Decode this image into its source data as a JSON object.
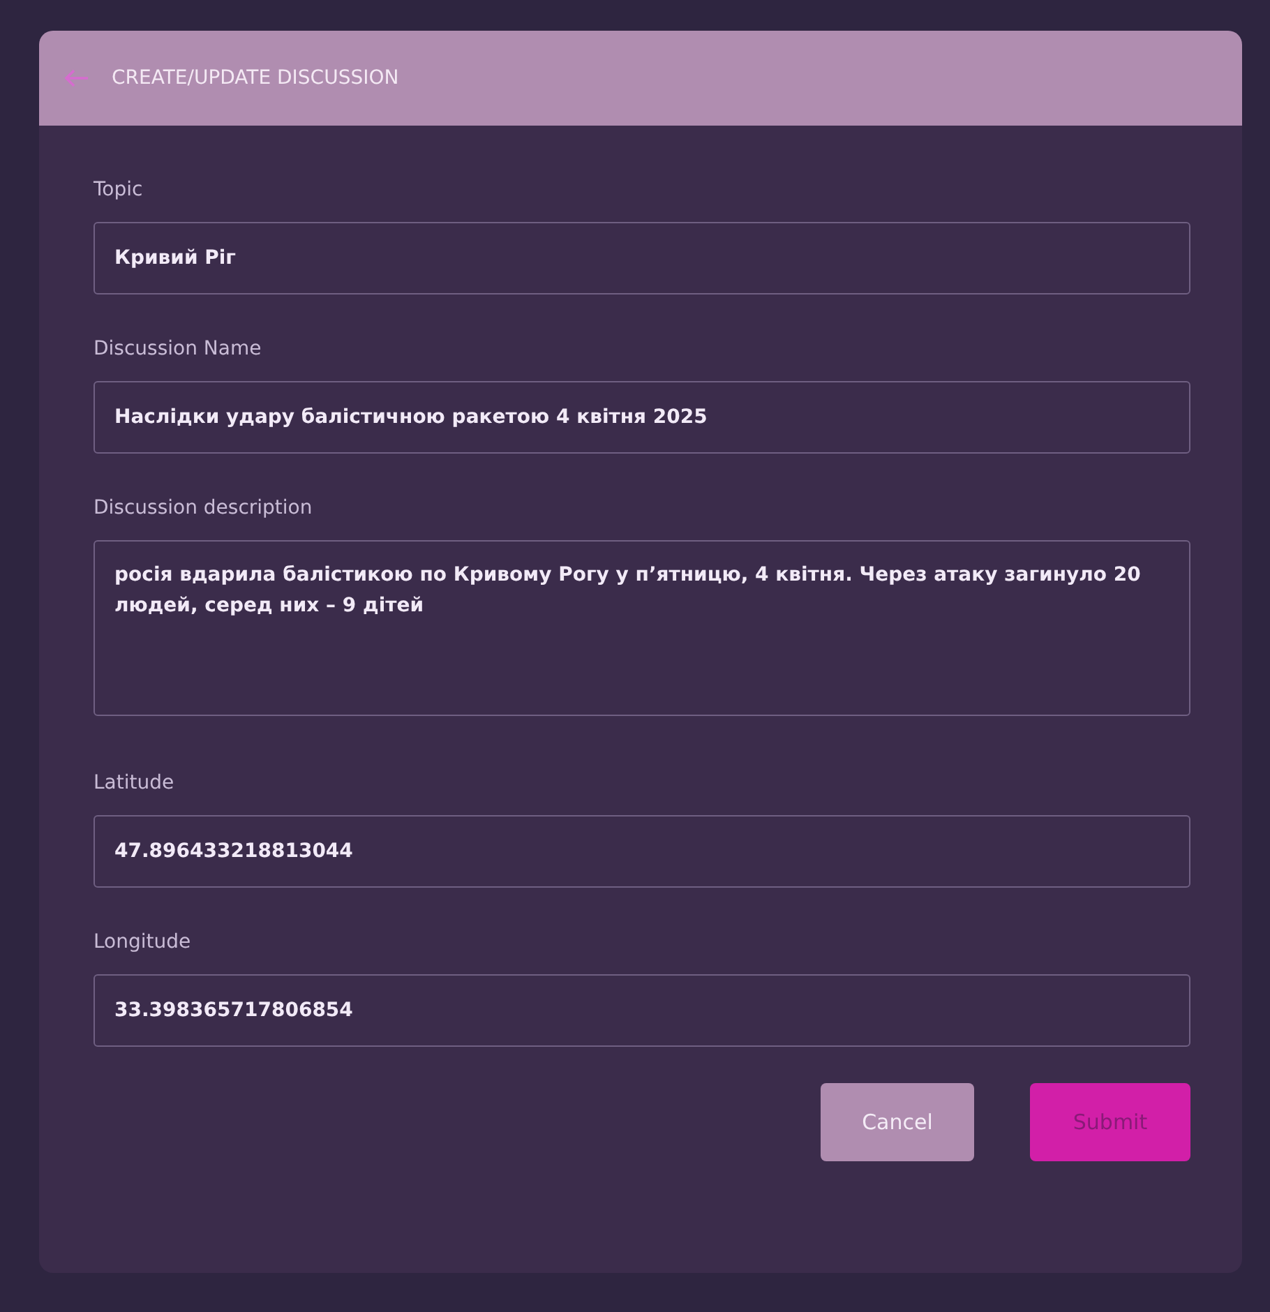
{
  "header": {
    "title": "CREATE/UPDATE DISCUSSION"
  },
  "fields": [
    {
      "kind": "input",
      "label": "Topic",
      "value": "Кривий Ріг"
    },
    {
      "kind": "input",
      "label": "Discussion Name",
      "value": "Наслідки удару балістичною ракетою 4 квітня 2025"
    },
    {
      "kind": "textarea",
      "label": "Discussion description",
      "value": "росія вдарила балістикою по Кривому Рогу у п’ятницю, 4 квітня. Через атаку загинуло 20 людей, серед них – 9 дітей"
    },
    {
      "kind": "input",
      "label": "Latitude",
      "value": "47.896433218813044"
    },
    {
      "kind": "input",
      "label": "Longitude",
      "value": "33.398365717806854"
    }
  ],
  "buttons": [
    {
      "kind": "secondary",
      "label": "Cancel"
    },
    {
      "kind": "primary",
      "label": "Submit"
    }
  ]
}
